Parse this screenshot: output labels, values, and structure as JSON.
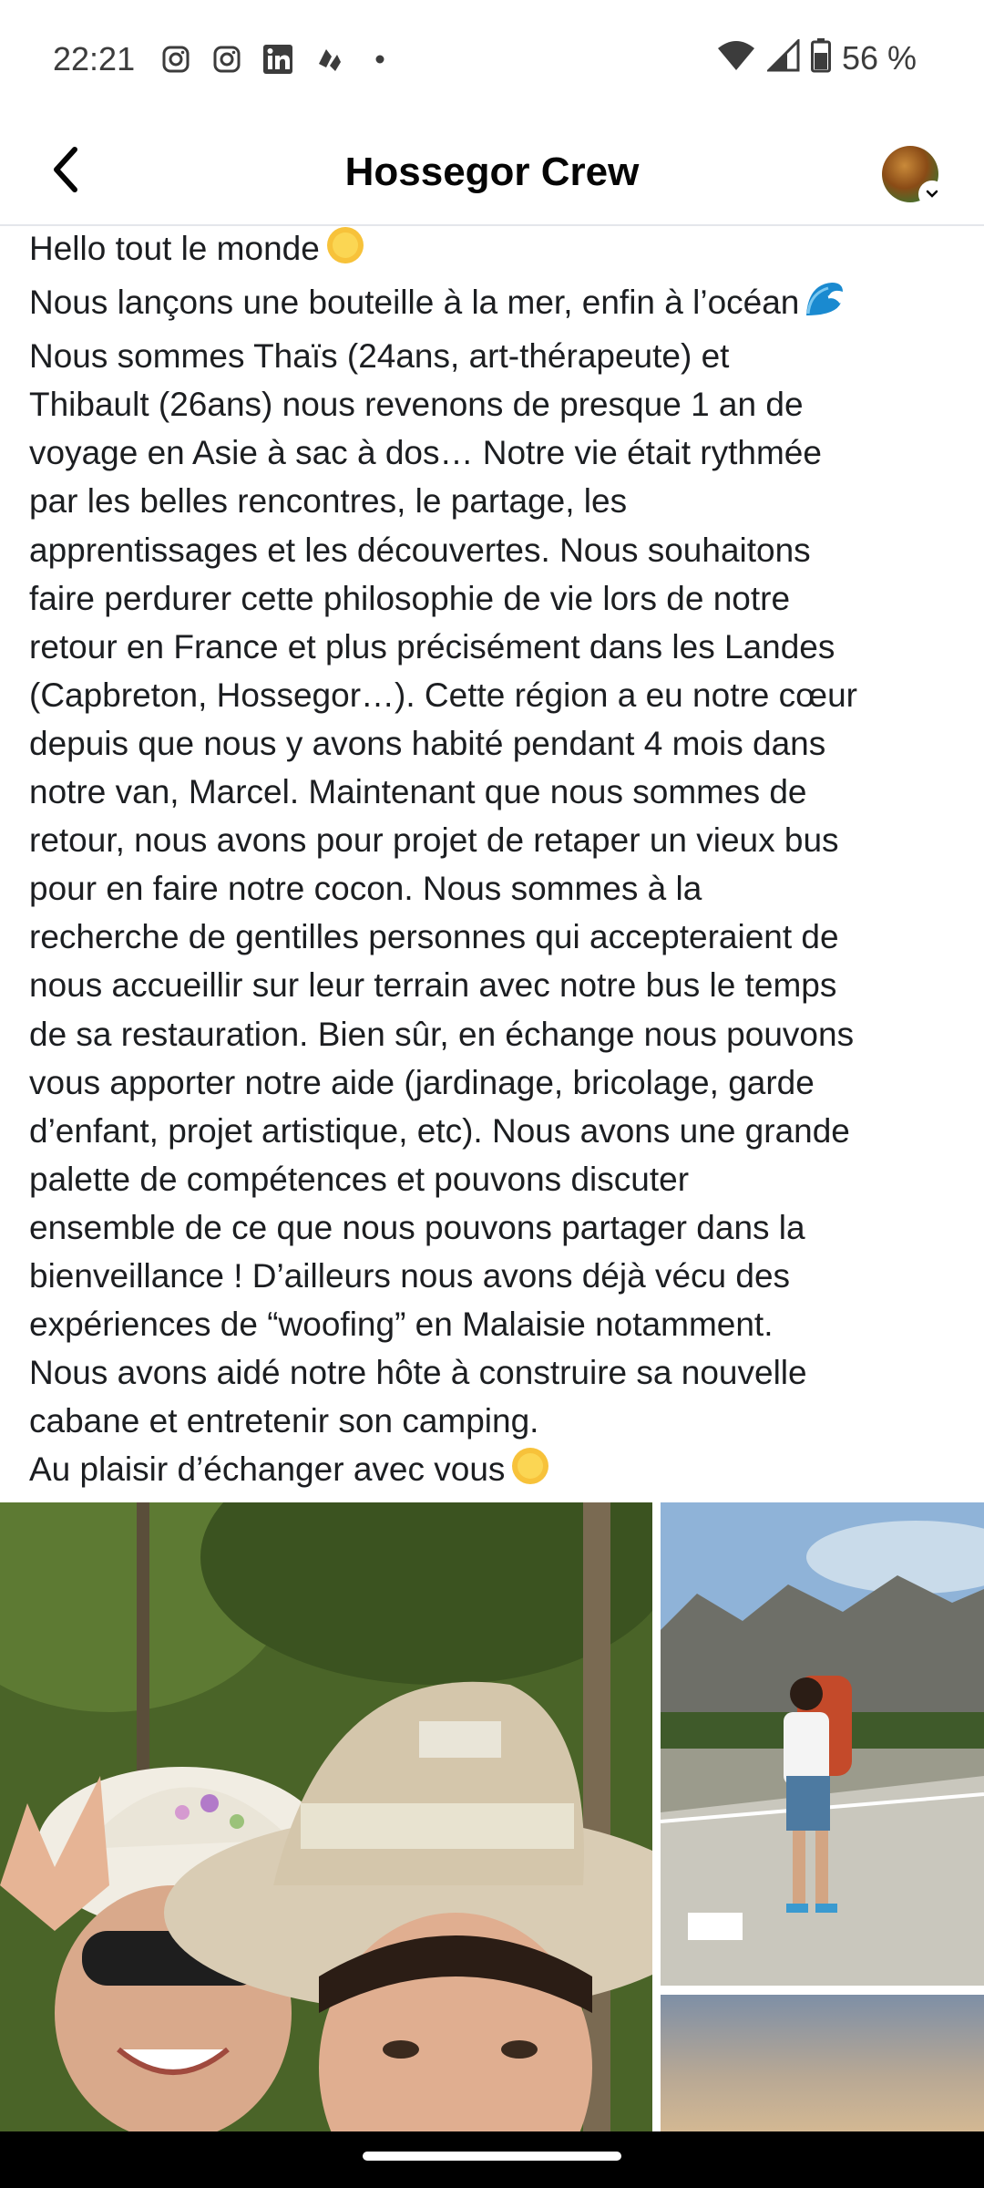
{
  "status_bar": {
    "time": "22:21",
    "notification_icons": [
      "instagram-icon",
      "instagram-icon",
      "linkedin-icon",
      "app-icon",
      "more-dot-icon"
    ],
    "battery_percent": "56 %"
  },
  "header": {
    "title": "Hossegor Crew",
    "back_icon": "chevron-left-icon"
  },
  "post": {
    "lines": [
      "Hello tout le monde",
      "Nous lançons une bouteille à la mer, enfin à l’océan",
      "Nous  sommes Thaïs (24ans, art-thérapeute) et",
      "Thibault (26ans) nous revenons de presque 1 an de",
      "voyage en Asie à sac à dos… Notre vie était rythmée",
      "par les belles rencontres, le partage, les",
      "apprentissages et les découvertes. Nous souhaitons",
      "faire perdurer cette philosophie de vie lors de notre",
      "retour en France et plus précisément dans les Landes",
      "(Capbreton, Hossegor…). Cette région a eu notre cœur",
      "depuis que nous y avons habité pendant 4 mois dans",
      "notre van, Marcel. Maintenant que nous sommes de",
      "retour, nous avons pour projet de retaper un vieux bus",
      "pour en faire notre cocon. Nous sommes à la",
      "recherche de gentilles personnes qui accepteraient de",
      "nous accueillir sur leur terrain avec notre bus le temps",
      "de sa restauration. Bien sûr, en échange nous pouvons",
      "vous apporter notre aide (jardinage, bricolage, garde",
      "d’enfant, projet artistique, etc). Nous avons une grande",
      "palette de compétences et pouvons discuter",
      "ensemble de ce que nous pouvons partager dans la",
      "bienveillance ! D’ailleurs nous avons déjà vécu des",
      "expériences de  “woofing” en Malaisie notamment.",
      "Nous avons aidé notre hôte à construire sa nouvelle",
      "cabane et entretenir son camping.",
      "Au plaisir d’échanger avec vous"
    ],
    "emojis": {
      "line1": "sun-emoji",
      "line2": "wave-emoji",
      "line26": "sun-emoji"
    }
  },
  "photos": [
    {
      "name": "selfie-photo",
      "subject": "couple selfie with hats in forest"
    },
    {
      "name": "hiker-photo",
      "subject": "backpacker walking on road with mountains"
    },
    {
      "name": "sky-photo",
      "subject": "sky at dusk"
    }
  ],
  "colors": {
    "title": "#050505",
    "text": "#1c1e21",
    "divider": "#e4e6eb"
  }
}
